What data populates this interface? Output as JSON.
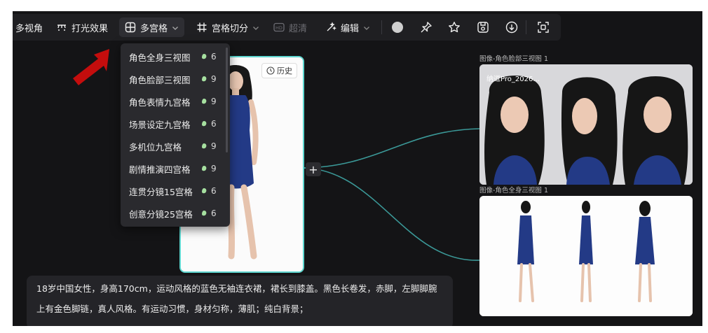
{
  "toolbar": {
    "multi_view_label": "多视角",
    "lighting_label": "打光效果",
    "multi_grid_label": "多宫格",
    "grid_split_label": "宫格切分",
    "hd_label": "超清",
    "edit_label": "编辑"
  },
  "dropdown": {
    "items": [
      {
        "label": "角色全身三视图",
        "cost": "6"
      },
      {
        "label": "角色脸部三视图",
        "cost": "9"
      },
      {
        "label": "角色表情九宫格",
        "cost": "9"
      },
      {
        "label": "场景设定九宫格",
        "cost": "6"
      },
      {
        "label": "多机位九宫格",
        "cost": "9"
      },
      {
        "label": "剧情推演四宫格",
        "cost": "9"
      },
      {
        "label": "连贯分镜15宫格",
        "cost": "6"
      },
      {
        "label": "创意分镜25宫格",
        "cost": "6"
      }
    ]
  },
  "character_card": {
    "history_label": "历史"
  },
  "face_node": {
    "title": "图像-角色脸部三视图 1",
    "tag": "纳逗Pro_2026..."
  },
  "body_node": {
    "title": "图像-角色全身三视图 1"
  },
  "prompt": {
    "text": "18岁中国女性，身高170cm，运动风格的蓝色无袖连衣裙，裙长到膝盖。黑色长卷发，赤脚，左脚脚腕上有金色脚链，真人风格。有运动习惯，身材匀称，薄肌；纯白背景；"
  },
  "colors": {
    "canvas_bg": "#141416",
    "toolbar_bg": "#1f1f22",
    "accent_teal": "#5ed6cf",
    "dress_blue": "#233a86",
    "arrow_red": "#c40d0d"
  }
}
